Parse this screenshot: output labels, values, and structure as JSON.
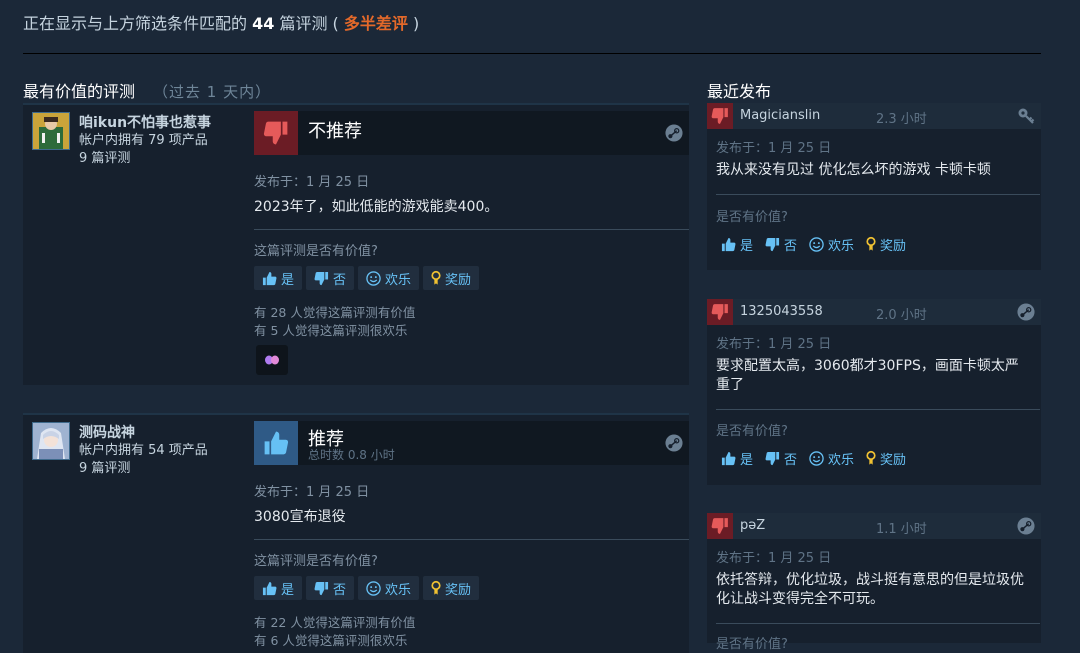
{
  "header": {
    "prefix": "正在显示与上方筛选条件匹配的 ",
    "count": "44",
    "middle": " 篇评测 ( ",
    "summary": "多半差评",
    "suffix": " )"
  },
  "most_helpful": {
    "title": "最有价值的评测",
    "subtitle": "（过去 1 天内）"
  },
  "recent": {
    "title": "最近发布"
  },
  "colors": {
    "background": "#1b2838",
    "accent": "#67c1f5",
    "negative": "#e4692a",
    "thumb_down_bg": "#6b1c25",
    "thumb_up_bg": "#2f5a86"
  },
  "reviews": [
    {
      "username": "咱ikun不怕事也惹事",
      "products": "帐户内拥有 79 项产品",
      "review_count": "9 篇评测",
      "vote": "不推荐",
      "playtime": "",
      "posted": "发布于：1 月 25 日",
      "content": "2023年了，如此低能的游戏能卖400。",
      "helpful_q": "这篇评测是否有价值?",
      "yes": "是",
      "no": "否",
      "funny": "欢乐",
      "award": "奖励",
      "helpful_stat": "有 28 人觉得这篇评测有价值",
      "funny_stat": "有 5 人觉得这篇评测很欢乐"
    },
    {
      "username": "测码战神",
      "products": "帐户内拥有 54 项产品",
      "review_count": "9 篇评测",
      "vote": "推荐",
      "playtime": "总时数 0.8 小时",
      "posted": "发布于：1 月 25 日",
      "content": "3080宣布退役",
      "helpful_q": "这篇评测是否有价值?",
      "yes": "是",
      "no": "否",
      "funny": "欢乐",
      "award": "奖励",
      "helpful_stat": "有 22 人觉得这篇评测有价值",
      "funny_stat": "有 6 人觉得这篇评测很欢乐"
    }
  ],
  "recent_reviews": [
    {
      "name": "Magicianslin",
      "hours": "2.3 小时",
      "posted": "发布于：1 月 25 日",
      "content": "我从来没有见过 优化怎么坏的游戏 卡顿卡顿",
      "helpful_q": "是否有价值?",
      "yes": "是",
      "no": "否",
      "funny": "欢乐",
      "award": "奖励",
      "platform_icon": "key-icon"
    },
    {
      "name": "1325043558",
      "hours": "2.0 小时",
      "posted": "发布于：1 月 25 日",
      "content": "要求配置太高，3060都才30FPS，画面卡顿太严重了",
      "helpful_q": "是否有价值?",
      "yes": "是",
      "no": "否",
      "funny": "欢乐",
      "award": "奖励",
      "platform_icon": "steam-icon"
    },
    {
      "name": "pəZ",
      "hours": "1.1 小时",
      "posted": "发布于：1 月 25 日",
      "content": "依托答辩，优化垃圾，战斗挺有意思的但是垃圾优化让战斗变得完全不可玩。",
      "helpful_q": "是否有价值?",
      "platform_icon": "steam-icon"
    }
  ]
}
